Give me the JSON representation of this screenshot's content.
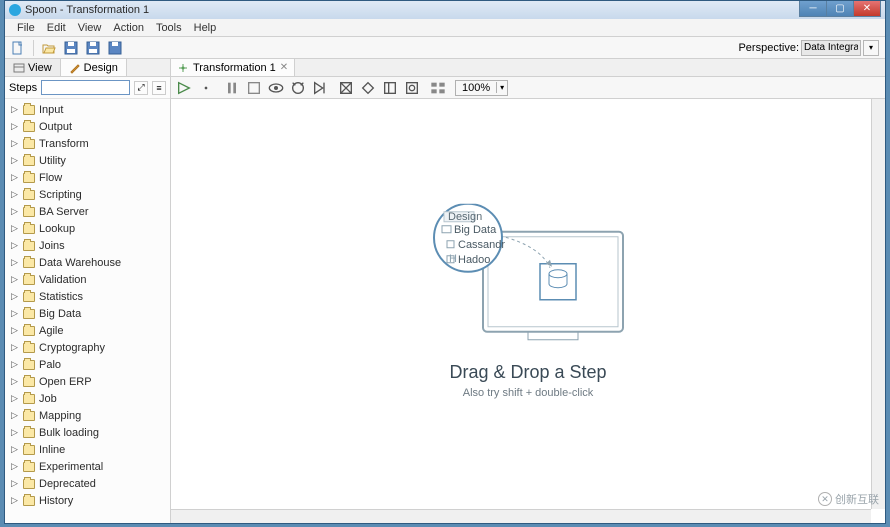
{
  "window": {
    "title": "Spoon - Transformation 1"
  },
  "menubar": [
    "File",
    "Edit",
    "View",
    "Action",
    "Tools",
    "Help"
  ],
  "perspective": {
    "label": "Perspective:",
    "value": "Data Integration"
  },
  "sidebar": {
    "tabs": {
      "view": "View",
      "design": "Design"
    },
    "steps_label": "Steps",
    "search": "",
    "categories": [
      "Input",
      "Output",
      "Transform",
      "Utility",
      "Flow",
      "Scripting",
      "BA Server",
      "Lookup",
      "Joins",
      "Data Warehouse",
      "Validation",
      "Statistics",
      "Big Data",
      "Agile",
      "Cryptography",
      "Palo",
      "Open ERP",
      "Job",
      "Mapping",
      "Bulk loading",
      "Inline",
      "Experimental",
      "Deprecated",
      "History"
    ]
  },
  "canvas": {
    "tab": "Transformation 1",
    "zoom": "100%",
    "hint_title": "Drag & Drop a Step",
    "hint_sub": "Also try shift + double-click",
    "illus": {
      "tab_label": "Design",
      "item1": "Big Data",
      "item2": "Cassandr",
      "item3": "Hadoo"
    }
  },
  "watermark": "创新互联"
}
